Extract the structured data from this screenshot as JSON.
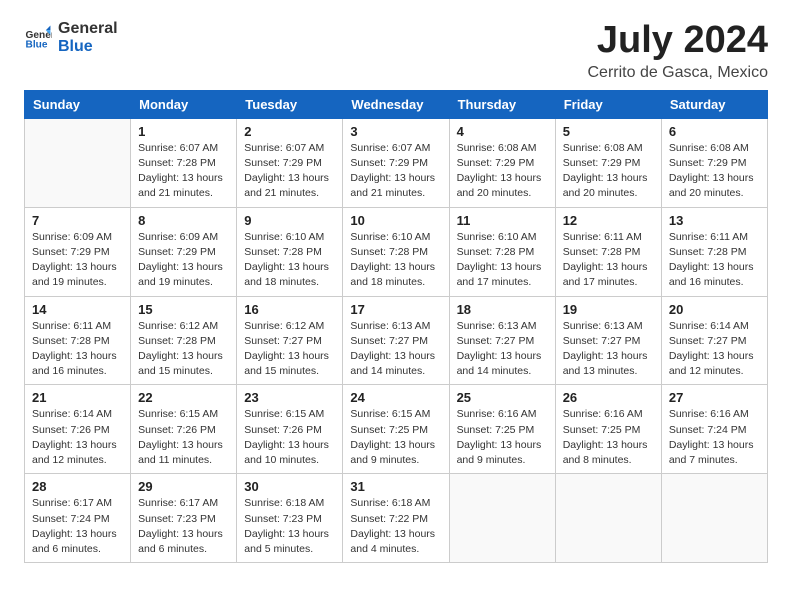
{
  "header": {
    "logo_general": "General",
    "logo_blue": "Blue",
    "month_title": "July 2024",
    "location": "Cerrito de Gasca, Mexico"
  },
  "weekdays": [
    "Sunday",
    "Monday",
    "Tuesday",
    "Wednesday",
    "Thursday",
    "Friday",
    "Saturday"
  ],
  "weeks": [
    [
      {
        "day": "",
        "sunrise": "",
        "sunset": "",
        "daylight": ""
      },
      {
        "day": "1",
        "sunrise": "Sunrise: 6:07 AM",
        "sunset": "Sunset: 7:28 PM",
        "daylight": "Daylight: 13 hours and 21 minutes."
      },
      {
        "day": "2",
        "sunrise": "Sunrise: 6:07 AM",
        "sunset": "Sunset: 7:29 PM",
        "daylight": "Daylight: 13 hours and 21 minutes."
      },
      {
        "day": "3",
        "sunrise": "Sunrise: 6:07 AM",
        "sunset": "Sunset: 7:29 PM",
        "daylight": "Daylight: 13 hours and 21 minutes."
      },
      {
        "day": "4",
        "sunrise": "Sunrise: 6:08 AM",
        "sunset": "Sunset: 7:29 PM",
        "daylight": "Daylight: 13 hours and 20 minutes."
      },
      {
        "day": "5",
        "sunrise": "Sunrise: 6:08 AM",
        "sunset": "Sunset: 7:29 PM",
        "daylight": "Daylight: 13 hours and 20 minutes."
      },
      {
        "day": "6",
        "sunrise": "Sunrise: 6:08 AM",
        "sunset": "Sunset: 7:29 PM",
        "daylight": "Daylight: 13 hours and 20 minutes."
      }
    ],
    [
      {
        "day": "7",
        "sunrise": "Sunrise: 6:09 AM",
        "sunset": "Sunset: 7:29 PM",
        "daylight": "Daylight: 13 hours and 19 minutes."
      },
      {
        "day": "8",
        "sunrise": "Sunrise: 6:09 AM",
        "sunset": "Sunset: 7:29 PM",
        "daylight": "Daylight: 13 hours and 19 minutes."
      },
      {
        "day": "9",
        "sunrise": "Sunrise: 6:10 AM",
        "sunset": "Sunset: 7:28 PM",
        "daylight": "Daylight: 13 hours and 18 minutes."
      },
      {
        "day": "10",
        "sunrise": "Sunrise: 6:10 AM",
        "sunset": "Sunset: 7:28 PM",
        "daylight": "Daylight: 13 hours and 18 minutes."
      },
      {
        "day": "11",
        "sunrise": "Sunrise: 6:10 AM",
        "sunset": "Sunset: 7:28 PM",
        "daylight": "Daylight: 13 hours and 17 minutes."
      },
      {
        "day": "12",
        "sunrise": "Sunrise: 6:11 AM",
        "sunset": "Sunset: 7:28 PM",
        "daylight": "Daylight: 13 hours and 17 minutes."
      },
      {
        "day": "13",
        "sunrise": "Sunrise: 6:11 AM",
        "sunset": "Sunset: 7:28 PM",
        "daylight": "Daylight: 13 hours and 16 minutes."
      }
    ],
    [
      {
        "day": "14",
        "sunrise": "Sunrise: 6:11 AM",
        "sunset": "Sunset: 7:28 PM",
        "daylight": "Daylight: 13 hours and 16 minutes."
      },
      {
        "day": "15",
        "sunrise": "Sunrise: 6:12 AM",
        "sunset": "Sunset: 7:28 PM",
        "daylight": "Daylight: 13 hours and 15 minutes."
      },
      {
        "day": "16",
        "sunrise": "Sunrise: 6:12 AM",
        "sunset": "Sunset: 7:27 PM",
        "daylight": "Daylight: 13 hours and 15 minutes."
      },
      {
        "day": "17",
        "sunrise": "Sunrise: 6:13 AM",
        "sunset": "Sunset: 7:27 PM",
        "daylight": "Daylight: 13 hours and 14 minutes."
      },
      {
        "day": "18",
        "sunrise": "Sunrise: 6:13 AM",
        "sunset": "Sunset: 7:27 PM",
        "daylight": "Daylight: 13 hours and 14 minutes."
      },
      {
        "day": "19",
        "sunrise": "Sunrise: 6:13 AM",
        "sunset": "Sunset: 7:27 PM",
        "daylight": "Daylight: 13 hours and 13 minutes."
      },
      {
        "day": "20",
        "sunrise": "Sunrise: 6:14 AM",
        "sunset": "Sunset: 7:27 PM",
        "daylight": "Daylight: 13 hours and 12 minutes."
      }
    ],
    [
      {
        "day": "21",
        "sunrise": "Sunrise: 6:14 AM",
        "sunset": "Sunset: 7:26 PM",
        "daylight": "Daylight: 13 hours and 12 minutes."
      },
      {
        "day": "22",
        "sunrise": "Sunrise: 6:15 AM",
        "sunset": "Sunset: 7:26 PM",
        "daylight": "Daylight: 13 hours and 11 minutes."
      },
      {
        "day": "23",
        "sunrise": "Sunrise: 6:15 AM",
        "sunset": "Sunset: 7:26 PM",
        "daylight": "Daylight: 13 hours and 10 minutes."
      },
      {
        "day": "24",
        "sunrise": "Sunrise: 6:15 AM",
        "sunset": "Sunset: 7:25 PM",
        "daylight": "Daylight: 13 hours and 9 minutes."
      },
      {
        "day": "25",
        "sunrise": "Sunrise: 6:16 AM",
        "sunset": "Sunset: 7:25 PM",
        "daylight": "Daylight: 13 hours and 9 minutes."
      },
      {
        "day": "26",
        "sunrise": "Sunrise: 6:16 AM",
        "sunset": "Sunset: 7:25 PM",
        "daylight": "Daylight: 13 hours and 8 minutes."
      },
      {
        "day": "27",
        "sunrise": "Sunrise: 6:16 AM",
        "sunset": "Sunset: 7:24 PM",
        "daylight": "Daylight: 13 hours and 7 minutes."
      }
    ],
    [
      {
        "day": "28",
        "sunrise": "Sunrise: 6:17 AM",
        "sunset": "Sunset: 7:24 PM",
        "daylight": "Daylight: 13 hours and 6 minutes."
      },
      {
        "day": "29",
        "sunrise": "Sunrise: 6:17 AM",
        "sunset": "Sunset: 7:23 PM",
        "daylight": "Daylight: 13 hours and 6 minutes."
      },
      {
        "day": "30",
        "sunrise": "Sunrise: 6:18 AM",
        "sunset": "Sunset: 7:23 PM",
        "daylight": "Daylight: 13 hours and 5 minutes."
      },
      {
        "day": "31",
        "sunrise": "Sunrise: 6:18 AM",
        "sunset": "Sunset: 7:22 PM",
        "daylight": "Daylight: 13 hours and 4 minutes."
      },
      {
        "day": "",
        "sunrise": "",
        "sunset": "",
        "daylight": ""
      },
      {
        "day": "",
        "sunrise": "",
        "sunset": "",
        "daylight": ""
      },
      {
        "day": "",
        "sunrise": "",
        "sunset": "",
        "daylight": ""
      }
    ]
  ]
}
